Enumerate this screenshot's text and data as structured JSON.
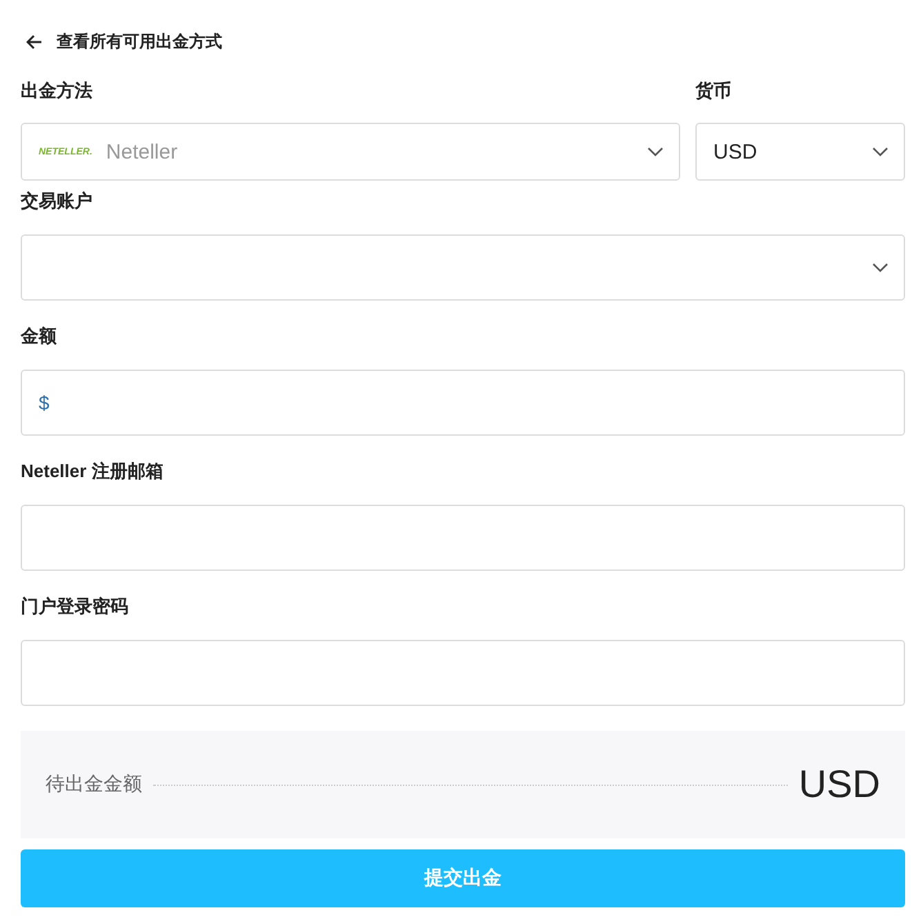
{
  "back_link": {
    "label": "查看所有可用出金方式"
  },
  "method_row": [
    {
      "label": "出金方法",
      "kind": "select",
      "logo_text": "NETELLER.",
      "placeholder": "Neteller"
    },
    {
      "label": "货币",
      "kind": "select",
      "value": "USD"
    }
  ],
  "fields": [
    {
      "label": "交易账户",
      "kind": "select"
    },
    {
      "label": "金额",
      "kind": "input",
      "prefix": "$"
    },
    {
      "label": "Neteller 注册邮箱",
      "kind": "input"
    },
    {
      "label": "门户登录密码",
      "kind": "input"
    }
  ],
  "summary": {
    "label": "待出金金额",
    "value": "USD"
  },
  "submit_button": "提交出金"
}
